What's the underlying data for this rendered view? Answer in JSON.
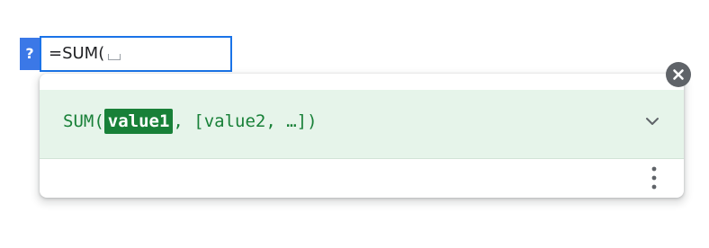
{
  "formula_bar": {
    "help_badge": "?",
    "formula_text": "=SUM("
  },
  "function_help": {
    "function_name": "SUM(",
    "active_param": "value1",
    "rest_params": ", [value2, …])"
  },
  "icons": {
    "close": "close-icon",
    "expand": "chevron-down-icon",
    "more": "more-vert-icon"
  },
  "colors": {
    "accent_blue": "#1a73e8",
    "badge_blue": "#3b78e7",
    "signature_green": "#188038",
    "signature_bg": "#e6f4ea",
    "close_grey": "#5f6368"
  }
}
